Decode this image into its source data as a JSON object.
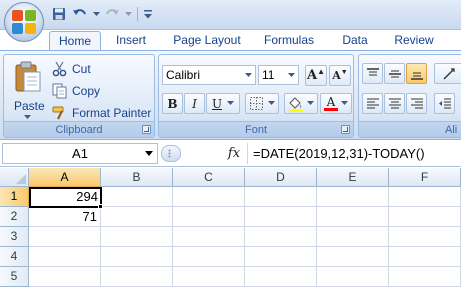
{
  "quick_access": {
    "items": [
      "save-icon",
      "undo-icon",
      "redo-icon",
      "customize-icon"
    ]
  },
  "tabs": [
    "Home",
    "Insert",
    "Page Layout",
    "Formulas",
    "Data",
    "Review"
  ],
  "active_tab": "Home",
  "ribbon": {
    "clipboard": {
      "label": "Clipboard",
      "paste": "Paste",
      "cut": "Cut",
      "copy": "Copy",
      "format_painter": "Format Painter"
    },
    "font": {
      "label": "Font",
      "font_name": "Calibri",
      "font_size": "11",
      "bold": "B",
      "italic": "I",
      "underline": "U",
      "grow": "A",
      "shrink": "A",
      "font_color_letter": "A",
      "highlight_color": "#ffff00",
      "font_color": "#ff0000"
    },
    "alignment": {
      "label": "Ali"
    }
  },
  "formula_bar": {
    "name_box": "A1",
    "fx": "fx",
    "formula": "=DATE(2019,12,31)-TODAY()"
  },
  "sheet": {
    "columns": [
      "A",
      "B",
      "C",
      "D",
      "E",
      "F"
    ],
    "rows": [
      "1",
      "2",
      "3",
      "4",
      "5"
    ],
    "cells": {
      "A1": "294",
      "A2": "71"
    },
    "selected_cell": "A1"
  },
  "colors": {
    "selection_highlight": "#f9c96c",
    "ribbon_text": "#15428b"
  }
}
